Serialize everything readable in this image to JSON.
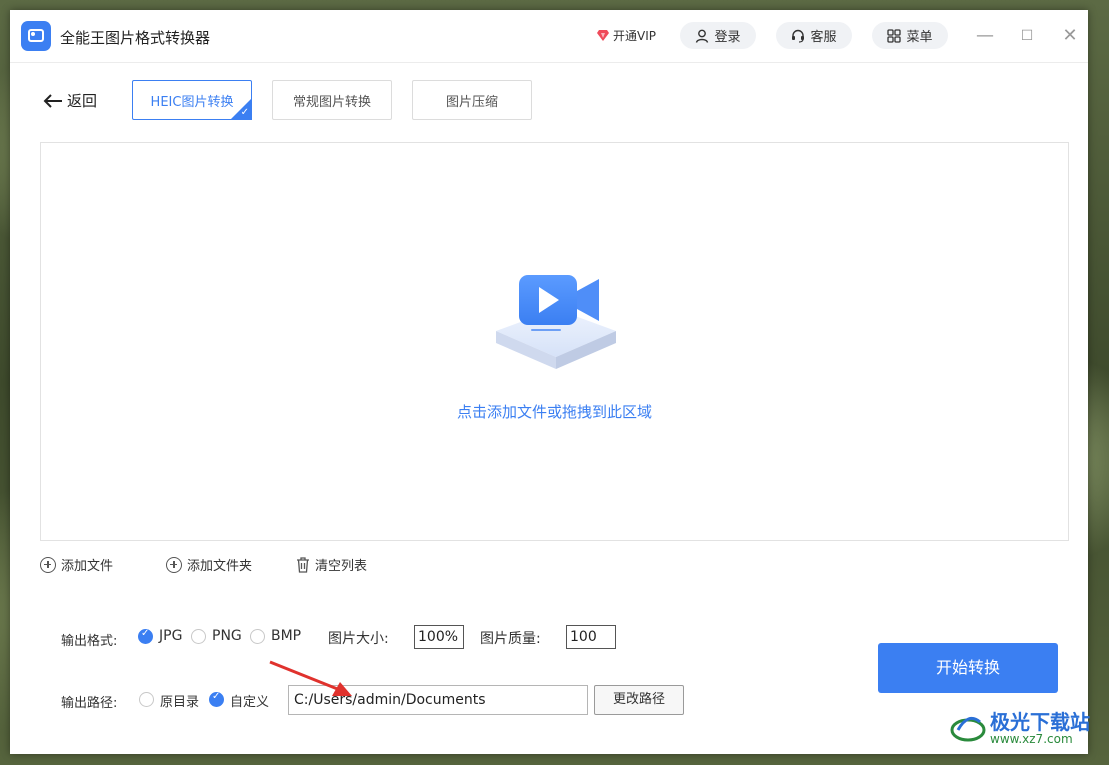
{
  "app": {
    "title": "全能王图片格式转换器"
  },
  "header": {
    "vip_label": "开通VIP",
    "login_label": "登录",
    "service_label": "客服",
    "menu_label": "菜单"
  },
  "nav": {
    "back_label": "返回",
    "tabs": [
      {
        "label": "HEIC图片转换",
        "active": true
      },
      {
        "label": "常规图片转换",
        "active": false
      },
      {
        "label": "图片压缩",
        "active": false
      }
    ]
  },
  "dropzone": {
    "hint": "点击添加文件或拖拽到此区域"
  },
  "actions": {
    "add_file": "添加文件",
    "add_folder": "添加文件夹",
    "clear_list": "清空列表"
  },
  "settings": {
    "format_label": "输出格式:",
    "formats": [
      {
        "label": "JPG",
        "selected": true
      },
      {
        "label": "PNG",
        "selected": false
      },
      {
        "label": "BMP",
        "selected": false
      }
    ],
    "size_label": "图片大小:",
    "size_value": "100%",
    "quality_label": "图片质量:",
    "quality_value": "100",
    "path_label": "输出路径:",
    "path_options": [
      {
        "label": "原目录",
        "selected": false
      },
      {
        "label": "自定义",
        "selected": true
      }
    ],
    "path_value": "C:/Users/admin/Documents",
    "change_path_label": "更改路径"
  },
  "start_button": {
    "label": "开始转换"
  },
  "watermark": {
    "title": "极光下载站",
    "url": "www.xz7.com"
  },
  "colors": {
    "accent": "#3b7ff2",
    "arrow": "#e0322d"
  }
}
